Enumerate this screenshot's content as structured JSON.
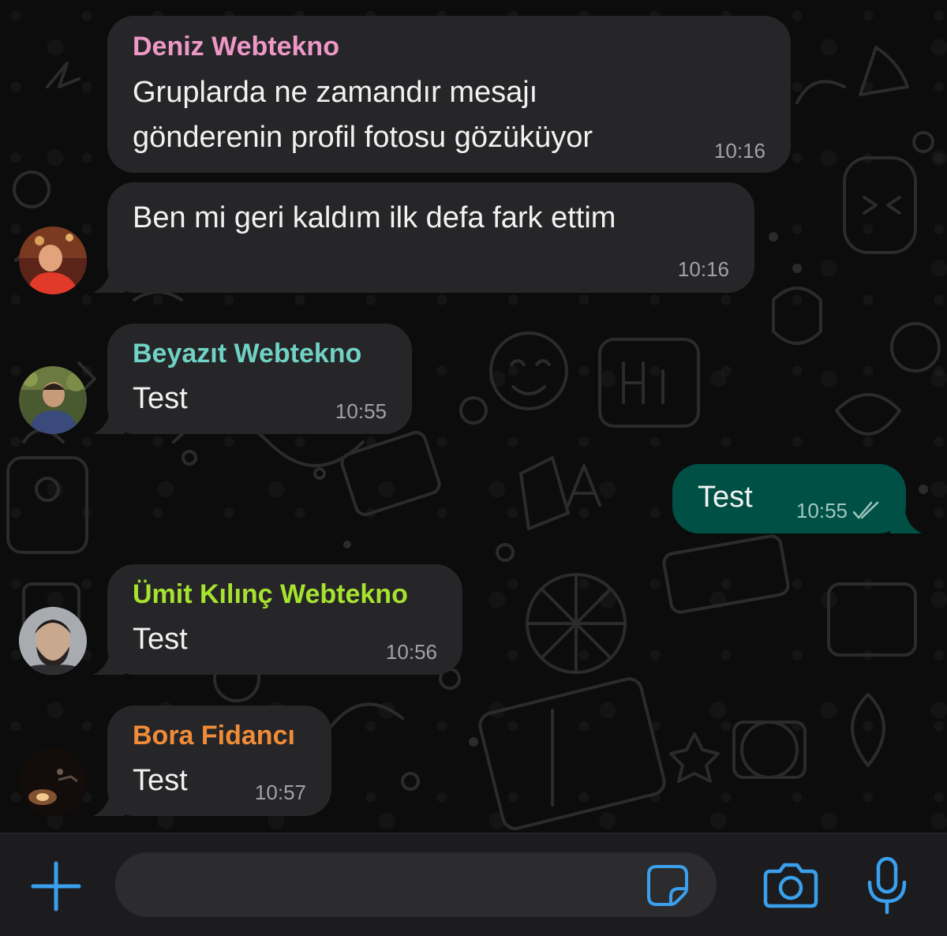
{
  "messages": [
    {
      "sender": "Deniz Webtekno",
      "lines": [
        "Gruplarda ne zamandır mesajı",
        "gönderenin profil fotosu gözüküyor"
      ],
      "time": "10:16"
    },
    {
      "sender": "",
      "lines": [
        "Ben mi geri kaldım ilk defa fark ettim"
      ],
      "time": "10:16"
    },
    {
      "sender": "Beyazıt Webtekno",
      "lines": [
        "Test"
      ],
      "time": "10:55"
    },
    {
      "sender": "",
      "lines": [
        "Test"
      ],
      "time": "10:55",
      "outgoing": true
    },
    {
      "sender": "Ümit Kılınç Webtekno",
      "lines": [
        "Test"
      ],
      "time": "10:56"
    },
    {
      "sender": "Bora Fidancı",
      "lines": [
        "Test"
      ],
      "time": "10:57"
    }
  ],
  "colors": {
    "deniz": "#ef98c8",
    "beyazit": "#6fd2c4",
    "umit": "#a6e22e",
    "bora": "#f08c38",
    "accent": "#3aa0ee",
    "incoming_bubble": "#262628",
    "outgoing_bubble": "#005045"
  },
  "composer": {
    "input_value": "",
    "icons": [
      "plus-icon",
      "sticker-icon",
      "camera-icon",
      "microphone-icon"
    ]
  }
}
